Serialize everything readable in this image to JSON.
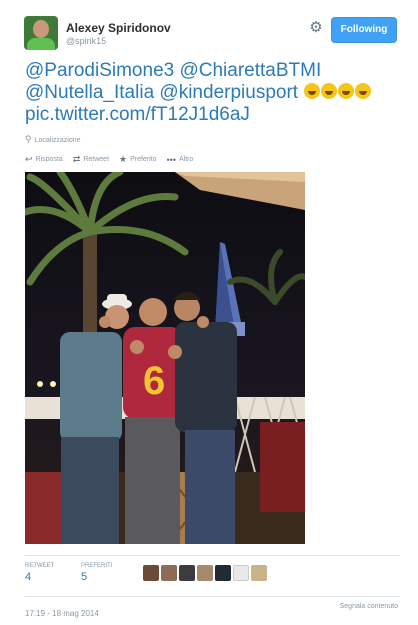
{
  "user": {
    "name": "Alexey Spiridonov",
    "handle": "@spirik15"
  },
  "follow_button": {
    "label": "Following",
    "color": "#3fa2f7"
  },
  "tweet": {
    "mentions": [
      "@ParodiSimone3",
      "@ChiarettaBTMI",
      "@Nutella_Italia",
      "@kinderpiusport"
    ],
    "link": "pic.twitter.com/fT12J1d6aJ",
    "emoji_count": 4
  },
  "location": {
    "label": "Localizzazione"
  },
  "actions": {
    "reply": "Risposta",
    "retweet": "Retweet",
    "favorite": "Preferito",
    "more": "Altro"
  },
  "stats": {
    "retweets_label": "RETWEET",
    "retweets": "4",
    "favorites_label": "PREFERITI",
    "favorites": "5",
    "favoriter_avatar_count": 7
  },
  "footer": {
    "timestamp": "17:19 - 18 mag 2014",
    "report": "Segnala contenuto"
  },
  "colors": {
    "link": "#2b7bb9",
    "muted": "#8899a6",
    "text": "#292f33"
  }
}
